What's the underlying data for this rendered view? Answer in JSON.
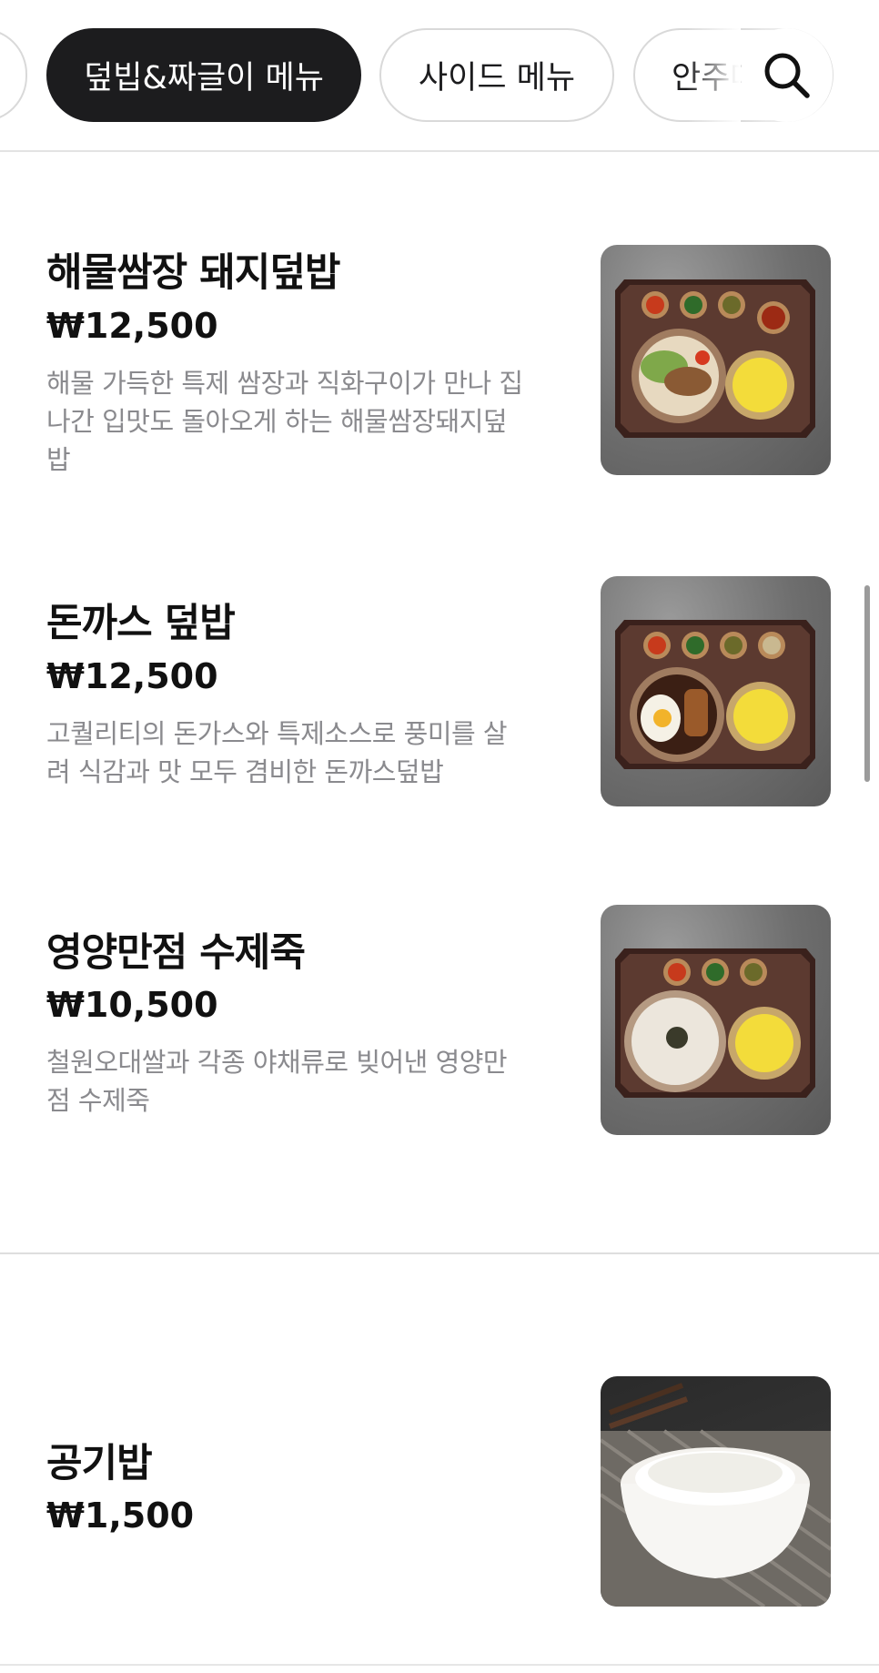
{
  "tabs": [
    {
      "label": ""
    },
    {
      "label": "덮빕&짜글이 메뉴",
      "active": true
    },
    {
      "label": "사이드 메뉴",
      "active": false
    },
    {
      "label": "안주메뉴",
      "active": false
    }
  ],
  "search": {
    "icon": "search-icon"
  },
  "menu_items": [
    {
      "name": "해물쌈장 돼지덮밥",
      "price": "₩12,500",
      "description": "해물 가득한 특제 쌈장과 직화구이가 만나 집나간 입맛도 돌아오게 하는 해물쌈장돼지덮밥",
      "image": "seafood-ssamjang-pork-rice-bowl-set"
    },
    {
      "name": "돈까스 덮밥",
      "price": "₩12,500",
      "description": "고퀄리티의 돈가스와 특제소스로 풍미를 살려 식감과 맛 모두 겸비한 돈까스덮밥",
      "image": "pork-cutlet-rice-bowl-set"
    },
    {
      "name": "영양만점 수제죽",
      "price": "₩10,500",
      "description": "철원오대쌀과 각종 야채류로 빚어낸 영양만점 수제죽",
      "image": "handmade-porridge-set"
    },
    {
      "name": "공기밥",
      "price": "₩1,500",
      "image": "bowl-of-rice"
    }
  ],
  "colors": {
    "active_tab_bg": "#1c1c1e",
    "active_tab_text": "#ffffff",
    "description_text": "#8a8a8e",
    "divider": "#dedede"
  }
}
